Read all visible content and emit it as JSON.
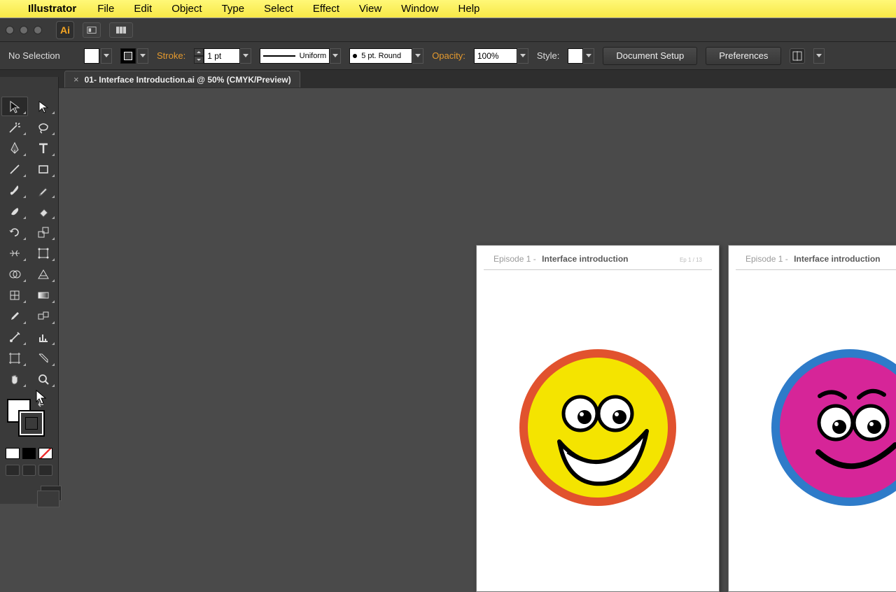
{
  "menu": {
    "app": "Illustrator",
    "items": [
      "File",
      "Edit",
      "Object",
      "Type",
      "Select",
      "Effect",
      "View",
      "Window",
      "Help"
    ]
  },
  "appbar": {
    "badge": "Ai"
  },
  "control": {
    "selection": "No Selection",
    "fill_color": "#ffffff",
    "stroke_color": "#000000",
    "stroke_label": "Stroke:",
    "stroke_weight": "1 pt",
    "profile": "Uniform",
    "brush": "5 pt. Round",
    "opacity_label": "Opacity:",
    "opacity": "100%",
    "style_label": "Style:",
    "doc_setup": "Document Setup",
    "prefs": "Preferences"
  },
  "tab": {
    "title": "01- Interface Introduction.ai @ 50% (CMYK/Preview)"
  },
  "artboards": {
    "a1": {
      "ep": "Episode 1 -",
      "title": "Interface introduction",
      "page": "Ep 1 / 13"
    },
    "a2": {
      "ep": "Episode 1 -",
      "title": "Interface introduction",
      "page": ""
    }
  },
  "colors": {
    "face1_fill": "#f4e400",
    "face1_ring": "#e1522e",
    "face2_fill": "#d62598",
    "face2_ring": "#2e7bc9"
  },
  "tools": [
    "selection-tool",
    "direct-selection-tool",
    "magic-wand-tool",
    "lasso-tool",
    "pen-tool",
    "type-tool",
    "line-tool",
    "rectangle-tool",
    "paintbrush-tool",
    "pencil-tool",
    "blob-brush-tool",
    "eraser-tool",
    "rotate-tool",
    "scale-tool",
    "width-tool",
    "free-transform-tool",
    "shape-builder-tool",
    "perspective-tool",
    "mesh-tool",
    "gradient-tool",
    "eyedropper-tool",
    "blend-tool",
    "symbol-sprayer-tool",
    "graph-tool",
    "artboard-tool",
    "slice-tool",
    "hand-tool",
    "zoom-tool"
  ]
}
